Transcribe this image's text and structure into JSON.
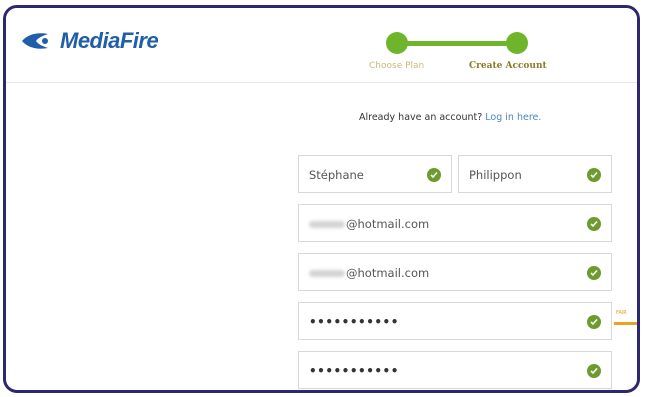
{
  "brand": {
    "name": "MediaFire",
    "color": "#1f5ea8"
  },
  "steps": {
    "items": [
      {
        "label": "Choose Plan",
        "state": "completed"
      },
      {
        "label": "Create Account",
        "state": "current"
      }
    ],
    "accent": "#6fb52c"
  },
  "login_prompt": {
    "text": "Already have an account? ",
    "link": "Log in here."
  },
  "form": {
    "first_name": "Stéphane",
    "last_name": "Philippon",
    "email_suffix": "@hotmail.com",
    "confirm_email_suffix": "@hotmail.com",
    "password_mask": "•••••••••••",
    "confirm_password_mask": "•••••••••••",
    "valid_icon": "check-circle-icon",
    "valid_color": "#6f9a2d"
  },
  "password_strength": {
    "label": "FAIR",
    "color": "#f0a020"
  }
}
